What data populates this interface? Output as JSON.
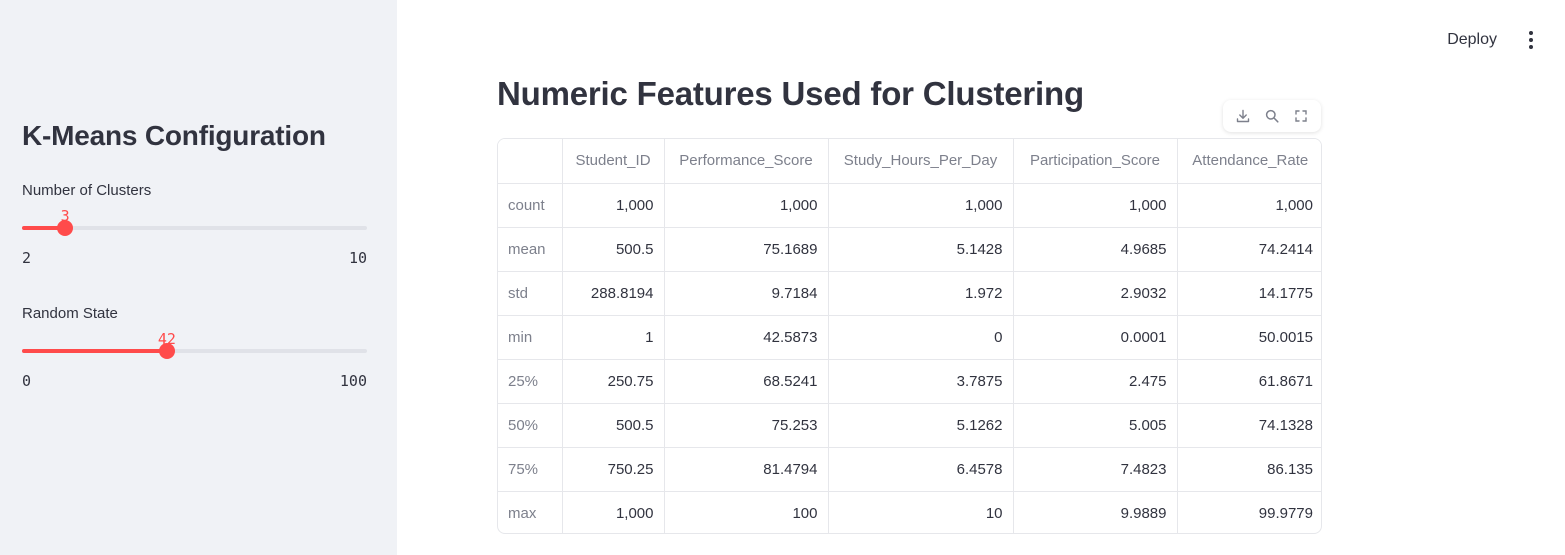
{
  "sidebar": {
    "title": "K-Means Configuration",
    "sliders": [
      {
        "label": "Number of Clusters",
        "value": 3,
        "min": 2,
        "max": 10
      },
      {
        "label": "Random State",
        "value": 42,
        "min": 0,
        "max": 100
      }
    ]
  },
  "topbar": {
    "deploy_label": "Deploy",
    "menu_icon": "more-vertical-icon"
  },
  "main": {
    "title": "Numeric Features Used for Clustering",
    "toolbar_icons": [
      "download-icon",
      "search-icon",
      "fullscreen-icon"
    ],
    "table": {
      "columns": [
        "",
        "Student_ID",
        "Performance_Score",
        "Study_Hours_Per_Day",
        "Participation_Score",
        "Attendance_Rate"
      ],
      "rows": [
        [
          "count",
          "1,000",
          "1,000",
          "1,000",
          "1,000",
          "1,000"
        ],
        [
          "mean",
          "500.5",
          "75.1689",
          "5.1428",
          "4.9685",
          "74.2414"
        ],
        [
          "std",
          "288.8194",
          "9.7184",
          "1.972",
          "2.9032",
          "14.1775"
        ],
        [
          "min",
          "1",
          "42.5873",
          "0",
          "0.0001",
          "50.0015"
        ],
        [
          "25%",
          "250.75",
          "68.5241",
          "3.7875",
          "2.475",
          "61.8671"
        ],
        [
          "50%",
          "500.5",
          "75.253",
          "5.1262",
          "5.005",
          "74.1328"
        ],
        [
          "75%",
          "750.25",
          "81.4794",
          "6.4578",
          "7.4823",
          "86.135"
        ],
        [
          "max",
          "1,000",
          "100",
          "10",
          "9.9889",
          "99.9779"
        ]
      ]
    }
  },
  "colors": {
    "accent": "#ff4b4b",
    "sidebar_bg": "#f0f2f6",
    "text": "#31333f",
    "muted": "#7d808c"
  }
}
